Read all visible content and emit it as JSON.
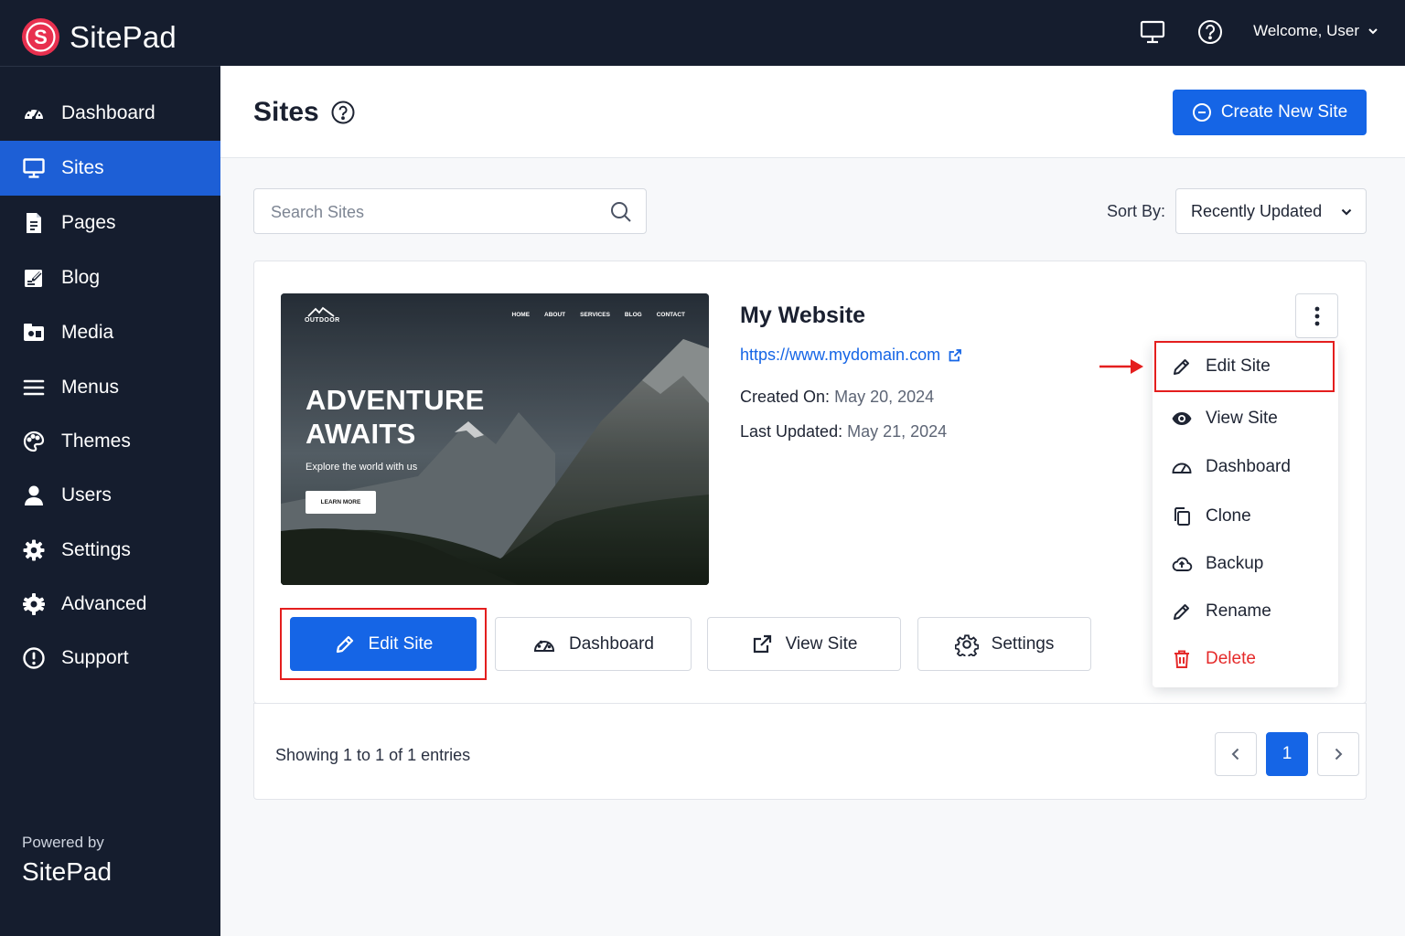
{
  "brand": {
    "name": "SitePad",
    "accent": "#e8304f",
    "primary": "#1565e6",
    "dark": "#151d2e"
  },
  "topbar": {
    "welcome": "Welcome, User"
  },
  "sidebar": {
    "items": [
      {
        "label": "Dashboard",
        "icon": "gauge-icon"
      },
      {
        "label": "Sites",
        "icon": "monitor-icon",
        "active": true
      },
      {
        "label": "Pages",
        "icon": "document-icon"
      },
      {
        "label": "Blog",
        "icon": "edit-note-icon"
      },
      {
        "label": "Media",
        "icon": "media-icon"
      },
      {
        "label": "Menus",
        "icon": "hamburger-icon"
      },
      {
        "label": "Themes",
        "icon": "palette-icon"
      },
      {
        "label": "Users",
        "icon": "user-icon"
      },
      {
        "label": "Settings",
        "icon": "gear-icon"
      },
      {
        "label": "Advanced",
        "icon": "cog-icon"
      },
      {
        "label": "Support",
        "icon": "support-icon"
      }
    ],
    "powered_by": "Powered by",
    "powered_brand": "SitePad"
  },
  "header": {
    "title": "Sites",
    "create_button": "Create New Site"
  },
  "search": {
    "placeholder": "Search Sites",
    "value": ""
  },
  "sort": {
    "label": "Sort By:",
    "selected": "Recently Updated"
  },
  "site": {
    "name": "My Website",
    "url": "https://www.mydomain.com",
    "created_label": "Created On:",
    "created": "May 20, 2024",
    "updated_label": "Last Updated:",
    "updated": "May 21, 2024",
    "thumbnail": {
      "logo": "OUTDOOR",
      "nav": [
        "HOME",
        "ABOUT",
        "SERVICES",
        "BLOG",
        "CONTACT"
      ],
      "headline_1": "ADVENTURE",
      "headline_2": "AWAITS",
      "subtitle": "Explore the world with us",
      "button": "LEARN MORE"
    }
  },
  "actions": {
    "edit": "Edit Site",
    "dashboard": "Dashboard",
    "view": "View Site",
    "settings": "Settings"
  },
  "menu": {
    "items": [
      {
        "label": "Edit Site",
        "icon": "pencil-icon"
      },
      {
        "label": "View Site",
        "icon": "eye-icon"
      },
      {
        "label": "Dashboard",
        "icon": "gauge-icon"
      },
      {
        "label": "Clone",
        "icon": "copy-icon"
      },
      {
        "label": "Backup",
        "icon": "cloud-upload-icon"
      },
      {
        "label": "Rename",
        "icon": "pencil-icon"
      },
      {
        "label": "Delete",
        "icon": "trash-icon",
        "danger": true
      }
    ]
  },
  "pagination": {
    "summary": "Showing 1 to 1 of 1 entries",
    "current_page": "1"
  }
}
